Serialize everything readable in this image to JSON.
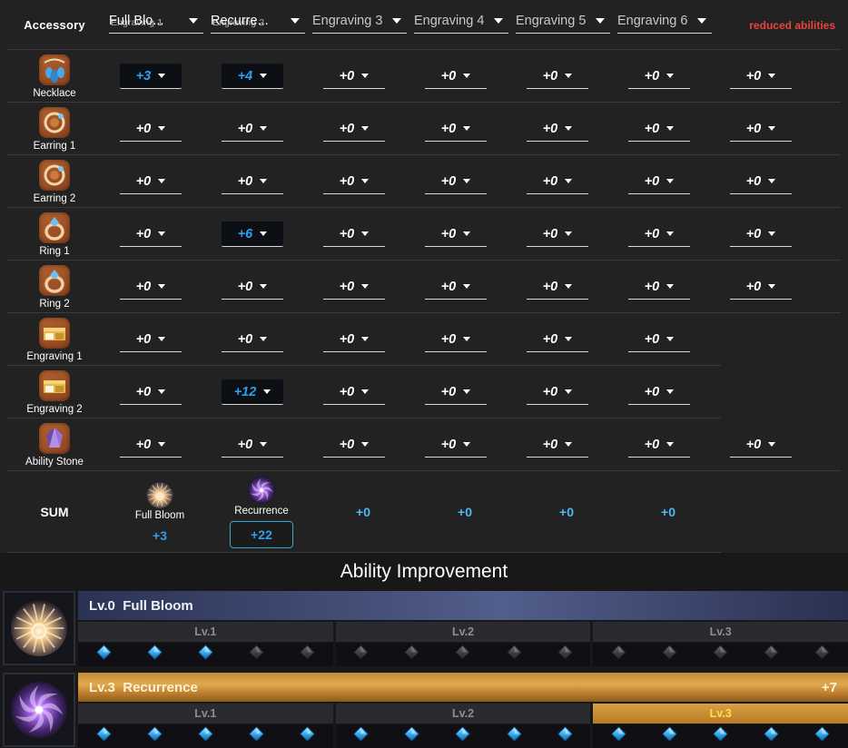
{
  "header": {
    "accessory_label": "Accessory",
    "engraving_slots": [
      {
        "label": "Engraving 1",
        "value": "Full Blo...",
        "selected": true
      },
      {
        "label": "Engraving 2",
        "value": "Recurre...",
        "selected": true
      },
      {
        "label": "",
        "value": "Engraving 3",
        "selected": false
      },
      {
        "label": "",
        "value": "Engraving 4",
        "selected": false
      },
      {
        "label": "",
        "value": "Engraving 5",
        "selected": false
      },
      {
        "label": "",
        "value": "Engraving 6",
        "selected": false
      }
    ],
    "reduced_abilities_label": "reduced abilities",
    "reduced_abilities_color": "#e8453c"
  },
  "rows": [
    {
      "name": "Necklace",
      "icon": "necklace-icon",
      "values": [
        "+3",
        "+4",
        "+0",
        "+0",
        "+0",
        "+0",
        "+0"
      ],
      "highlighted": [
        true,
        true,
        false,
        false,
        false,
        false,
        false
      ]
    },
    {
      "name": "Earring 1",
      "icon": "earring-icon",
      "values": [
        "+0",
        "+0",
        "+0",
        "+0",
        "+0",
        "+0",
        "+0"
      ],
      "highlighted": [
        false,
        false,
        false,
        false,
        false,
        false,
        false
      ]
    },
    {
      "name": "Earring 2",
      "icon": "earring-icon",
      "values": [
        "+0",
        "+0",
        "+0",
        "+0",
        "+0",
        "+0",
        "+0"
      ],
      "highlighted": [
        false,
        false,
        false,
        false,
        false,
        false,
        false
      ]
    },
    {
      "name": "Ring 1",
      "icon": "ring-icon",
      "values": [
        "+0",
        "+6",
        "+0",
        "+0",
        "+0",
        "+0",
        "+0"
      ],
      "highlighted": [
        false,
        true,
        false,
        false,
        false,
        false,
        false
      ]
    },
    {
      "name": "Ring 2",
      "icon": "ring-icon",
      "values": [
        "+0",
        "+0",
        "+0",
        "+0",
        "+0",
        "+0",
        "+0"
      ],
      "highlighted": [
        false,
        false,
        false,
        false,
        false,
        false,
        false
      ]
    },
    {
      "name": "Engraving 1",
      "icon": "engraving-book-icon",
      "values": [
        "+0",
        "+0",
        "+0",
        "+0",
        "+0",
        "+0"
      ],
      "highlighted": [
        false,
        false,
        false,
        false,
        false,
        false
      ]
    },
    {
      "name": "Engraving 2",
      "icon": "engraving-book-icon",
      "values": [
        "+0",
        "+12",
        "+0",
        "+0",
        "+0",
        "+0"
      ],
      "highlighted": [
        false,
        true,
        false,
        false,
        false,
        false
      ]
    },
    {
      "name": "Ability Stone",
      "icon": "ability-stone-icon",
      "values": [
        "+0",
        "+0",
        "+0",
        "+0",
        "+0",
        "+0",
        "+0"
      ],
      "highlighted": [
        false,
        false,
        false,
        false,
        false,
        false,
        false
      ]
    }
  ],
  "sum": {
    "label": "SUM",
    "columns": [
      {
        "engraving": "Full Bloom",
        "icon": "full-bloom-icon",
        "value": "+3",
        "boxed": false
      },
      {
        "engraving": "Recurrence",
        "icon": "recurrence-icon",
        "value": "+22",
        "boxed": true
      },
      {
        "engraving": "",
        "icon": "",
        "value": "+0",
        "boxed": false
      },
      {
        "engraving": "",
        "icon": "",
        "value": "+0",
        "boxed": false
      },
      {
        "engraving": "",
        "icon": "",
        "value": "+0",
        "boxed": false
      },
      {
        "engraving": "",
        "icon": "",
        "value": "+0",
        "boxed": false
      }
    ]
  },
  "ability_improvement": {
    "title": "Ability Improvement",
    "skills": [
      {
        "icon": "full-bloom-skill-icon",
        "level_prefix": "Lv.0",
        "name": "Full Bloom",
        "bonus": "",
        "theme": "blue",
        "active_level": -1,
        "levels": [
          {
            "label": "Lv.1",
            "gems_total": 5,
            "gems_filled": 3
          },
          {
            "label": "Lv.2",
            "gems_total": 5,
            "gems_filled": 0
          },
          {
            "label": "Lv.3",
            "gems_total": 5,
            "gems_filled": 0
          }
        ]
      },
      {
        "icon": "recurrence-skill-icon",
        "level_prefix": "Lv.3",
        "name": "Recurrence",
        "bonus": "+7",
        "theme": "gold",
        "active_level": 2,
        "levels": [
          {
            "label": "Lv.1",
            "gems_total": 5,
            "gems_filled": 5
          },
          {
            "label": "Lv.2",
            "gems_total": 5,
            "gems_filled": 5
          },
          {
            "label": "Lv.3",
            "gems_total": 5,
            "gems_filled": 5
          }
        ]
      }
    ]
  }
}
